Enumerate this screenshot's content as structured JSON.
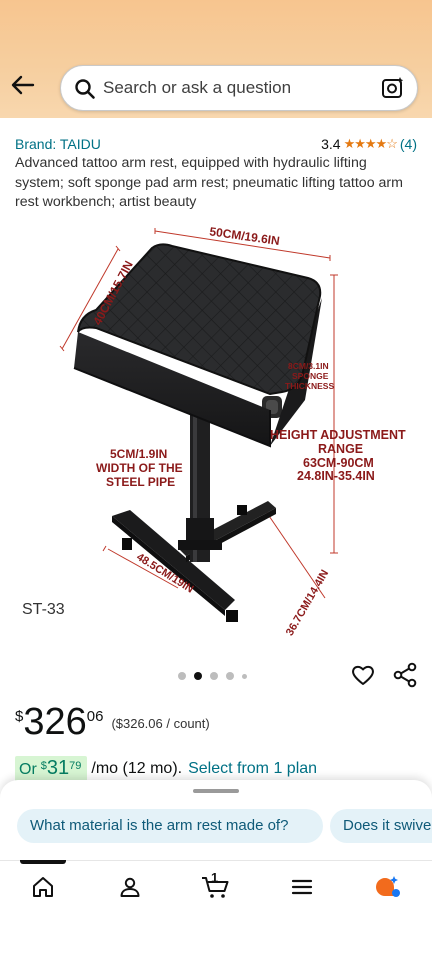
{
  "search": {
    "placeholder": "Search or ask a question"
  },
  "product": {
    "brand": "Brand: TAIDU",
    "rating_value": "3.4",
    "stars": "★★★★☆",
    "rating_count": "(4)",
    "title": "Advanced tattoo arm rest, equipped with hydraulic lifting system; soft sponge pad arm rest; pneumatic lifting tattoo arm rest workbench; artist beauty"
  },
  "image": {
    "sku": "ST-33",
    "labels": {
      "width": "50CM/19.6IN",
      "depth": "40CM/15.7IN",
      "sponge_1": "8CM/3.1IN",
      "sponge_2": "SPONGE",
      "sponge_3": "THICKNESS",
      "height_1": "HEIGHT ADJUSTMENT",
      "height_2": "RANGE",
      "height_3": "63CM-90CM",
      "height_4": "24.8IN-35.4IN",
      "pipe_1": "5CM/1.9IN",
      "pipe_2": "WIDTH OF THE",
      "pipe_3": "STEEL PIPE",
      "base_front": "48.5CM/19IN",
      "base_side": "36.7CM/14.4IN"
    },
    "dots_total": 5,
    "dots_active": 2
  },
  "price": {
    "symbol": "$",
    "whole": "326",
    "fraction": "06",
    "unit": "($326.06 / count)"
  },
  "plan": {
    "or": "Or",
    "symbol": "$",
    "whole": "31",
    "fraction": "79",
    "term": "/mo (12 mo).",
    "link": "Select from 1 plan"
  },
  "questions": {
    "chip_1": "What material is the arm rest made of?",
    "chip_2": "Does it swivel?"
  },
  "nav": {
    "cart_count": "1"
  },
  "colors": {
    "link": "#007185",
    "star": "#e47911",
    "header": "#f7c58f",
    "plan_bg": "#d7f5d3"
  }
}
